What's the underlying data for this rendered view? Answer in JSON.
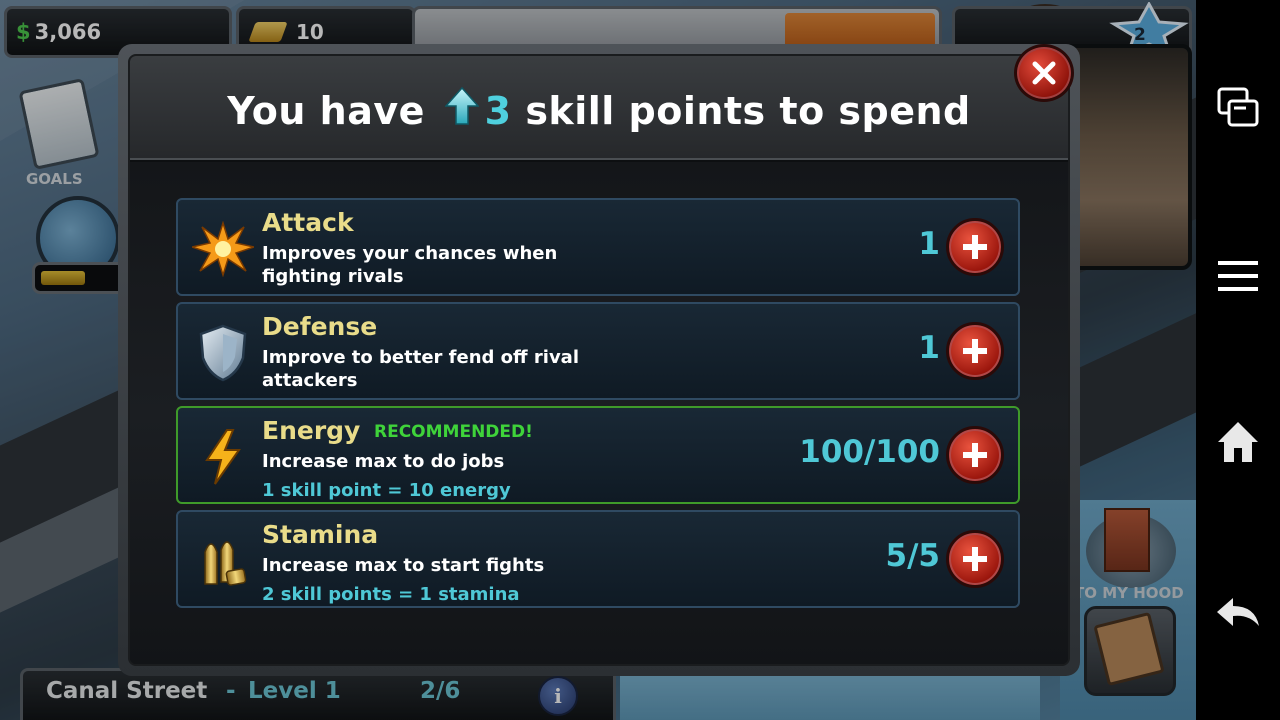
{
  "hud": {
    "cash": "3,066",
    "cash_symbol": "$",
    "gold": "10",
    "level": "2"
  },
  "sidebar_left": {
    "goals_label": "GOALS"
  },
  "sidebar_right": {
    "hood_label": "TO MY HOOD"
  },
  "location": {
    "name": "Canal Street",
    "separator": "-",
    "level": "Level 1",
    "progress": "2/6",
    "info_label": "i"
  },
  "modal": {
    "title_prefix": "You have",
    "points": "3",
    "title_suffix": "skill points to spend",
    "skills": [
      {
        "name": "Attack",
        "description": "Improves your chances when fighting rivals",
        "cost": "",
        "value": "1",
        "recommended": false,
        "icon": "explosion-icon"
      },
      {
        "name": "Defense",
        "description": "Improve to better fend off rival attackers",
        "cost": "",
        "value": "1",
        "recommended": false,
        "icon": "shield-icon"
      },
      {
        "name": "Energy",
        "description": "Increase max to do jobs",
        "cost": "1 skill point = 10 energy",
        "value": "100/100",
        "recommended": true,
        "recommended_label": "RECOMMENDED!",
        "icon": "lightning-icon"
      },
      {
        "name": "Stamina",
        "description": "Increase max to start fights",
        "cost": "2 skill points = 1 stamina",
        "value": "5/5",
        "recommended": false,
        "icon": "bullets-icon"
      }
    ]
  },
  "colors": {
    "accent_cyan": "#4fc8d6",
    "skill_name": "#e9dc8a",
    "recommended": "#3fd33a",
    "button_red": "#c8261a"
  }
}
